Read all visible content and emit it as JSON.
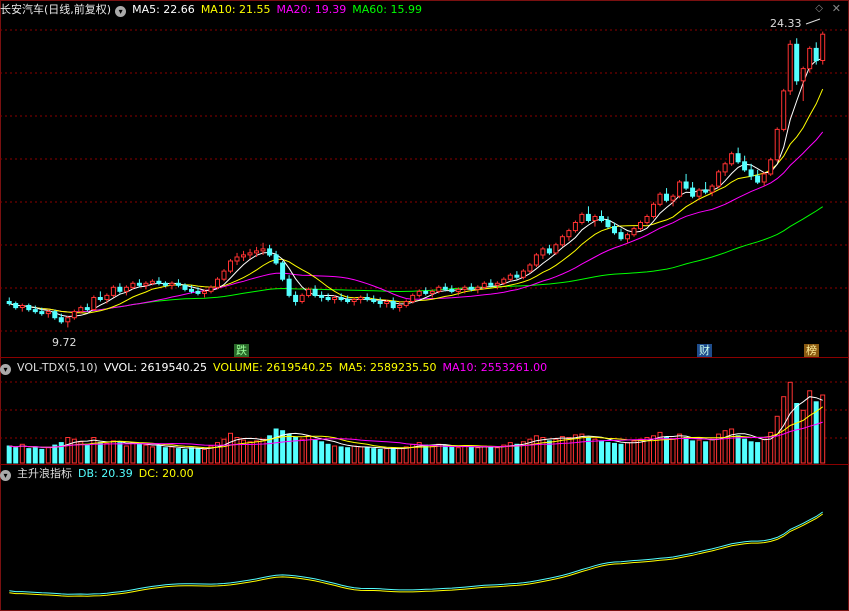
{
  "price_panel": {
    "title": "长安汽车(日线,前复权)",
    "ma5": "MA5: 22.66",
    "ma10": "MA10: 21.55",
    "ma20": "MA20: 19.39",
    "ma60": "MA60: 15.99",
    "high_label": "24.33",
    "low_label": "9.72",
    "markers": [
      "跌",
      "财",
      "榜"
    ]
  },
  "volume_panel": {
    "title": "VOL-TDX(5,10)",
    "vvol": "VVOL: 2619540.25",
    "volume": "VOLUME: 2619540.25",
    "ma5": "MA5: 2589235.50",
    "ma10": "MA10: 2553261.00"
  },
  "indicator_panel": {
    "title": "主升浪指标",
    "db": "DB: 20.39",
    "dc": "DC: 20.00"
  },
  "colors": {
    "up": "#ff3232",
    "down": "#54ffff",
    "ma5": "#ffffff",
    "ma10": "#ffff00",
    "ma20": "#ff00ff",
    "ma60": "#00ff00",
    "grid": "#8b0000"
  },
  "chart_data": [
    {
      "type": "candlestick",
      "title": "长安汽车(日线,前复权)",
      "ylim": [
        9,
        25
      ],
      "annotations": [
        {
          "label": "24.33",
          "value": 24.33
        },
        {
          "label": "9.72",
          "value": 9.72
        }
      ],
      "series": [
        {
          "name": "MA5",
          "value": 22.66
        },
        {
          "name": "MA10",
          "value": 21.55
        },
        {
          "name": "MA20",
          "value": 19.39
        },
        {
          "name": "MA60",
          "value": 15.99
        }
      ],
      "ohlc": [
        [
          11.0,
          11.2,
          10.8,
          10.9
        ],
        [
          10.9,
          11.0,
          10.6,
          10.7
        ],
        [
          10.7,
          10.9,
          10.5,
          10.8
        ],
        [
          10.8,
          10.9,
          10.5,
          10.6
        ],
        [
          10.6,
          10.8,
          10.4,
          10.5
        ],
        [
          10.5,
          10.7,
          10.3,
          10.4
        ],
        [
          10.4,
          10.6,
          10.2,
          10.5
        ],
        [
          10.5,
          10.6,
          10.1,
          10.2
        ],
        [
          10.2,
          10.4,
          9.9,
          10.0
        ],
        [
          10.0,
          10.3,
          9.72,
          10.2
        ],
        [
          10.2,
          10.6,
          10.1,
          10.5
        ],
        [
          10.5,
          10.8,
          10.4,
          10.7
        ],
        [
          10.7,
          10.9,
          10.5,
          10.6
        ],
        [
          10.6,
          11.3,
          10.6,
          11.2
        ],
        [
          11.2,
          11.5,
          11.0,
          11.1
        ],
        [
          11.1,
          11.4,
          10.9,
          11.3
        ],
        [
          11.3,
          11.8,
          11.2,
          11.7
        ],
        [
          11.7,
          11.9,
          11.4,
          11.5
        ],
        [
          11.5,
          11.8,
          11.3,
          11.7
        ],
        [
          11.7,
          12.0,
          11.6,
          11.9
        ],
        [
          11.9,
          12.1,
          11.7,
          11.8
        ],
        [
          11.8,
          12.0,
          11.6,
          11.9
        ],
        [
          11.9,
          12.1,
          11.8,
          12.0
        ],
        [
          12.0,
          12.2,
          11.8,
          11.9
        ],
        [
          11.9,
          12.0,
          11.7,
          11.8
        ],
        [
          11.8,
          12.0,
          11.6,
          11.9
        ],
        [
          11.9,
          12.1,
          11.7,
          11.8
        ],
        [
          11.8,
          11.9,
          11.5,
          11.6
        ],
        [
          11.6,
          11.8,
          11.4,
          11.5
        ],
        [
          11.5,
          11.7,
          11.3,
          11.4
        ],
        [
          11.4,
          11.6,
          11.2,
          11.5
        ],
        [
          11.5,
          11.8,
          11.4,
          11.7
        ],
        [
          11.7,
          12.2,
          11.6,
          12.1
        ],
        [
          12.1,
          12.6,
          12.0,
          12.5
        ],
        [
          12.5,
          13.1,
          12.4,
          13.0
        ],
        [
          13.0,
          13.4,
          12.8,
          13.2
        ],
        [
          13.2,
          13.5,
          13.0,
          13.3
        ],
        [
          13.3,
          13.6,
          13.1,
          13.4
        ],
        [
          13.4,
          13.7,
          13.2,
          13.5
        ],
        [
          13.5,
          13.9,
          13.3,
          13.6
        ],
        [
          13.6,
          13.8,
          13.2,
          13.3
        ],
        [
          13.3,
          13.5,
          12.8,
          12.9
        ],
        [
          12.9,
          13.0,
          12.0,
          12.1
        ],
        [
          12.1,
          12.3,
          11.2,
          11.3
        ],
        [
          11.3,
          11.5,
          10.8,
          11.0
        ],
        [
          11.0,
          11.4,
          10.9,
          11.3
        ],
        [
          11.3,
          11.7,
          11.2,
          11.6
        ],
        [
          11.6,
          11.8,
          11.2,
          11.3
        ],
        [
          11.3,
          11.5,
          11.0,
          11.2
        ],
        [
          11.2,
          11.4,
          11.0,
          11.1
        ],
        [
          11.1,
          11.3,
          10.9,
          11.2
        ],
        [
          11.2,
          11.4,
          11.0,
          11.1
        ],
        [
          11.1,
          11.3,
          10.9,
          11.0
        ],
        [
          11.0,
          11.2,
          10.8,
          11.1
        ],
        [
          11.1,
          11.3,
          10.9,
          11.2
        ],
        [
          11.2,
          11.4,
          11.0,
          11.1
        ],
        [
          11.1,
          11.3,
          10.9,
          11.0
        ],
        [
          11.0,
          11.2,
          10.7,
          10.9
        ],
        [
          10.9,
          11.1,
          10.7,
          11.0
        ],
        [
          11.0,
          11.2,
          10.6,
          10.7
        ],
        [
          10.7,
          11.0,
          10.5,
          10.8
        ],
        [
          10.8,
          11.1,
          10.7,
          11.0
        ],
        [
          11.0,
          11.4,
          10.9,
          11.3
        ],
        [
          11.3,
          11.6,
          11.2,
          11.5
        ],
        [
          11.5,
          11.7,
          11.3,
          11.4
        ],
        [
          11.4,
          11.6,
          11.2,
          11.5
        ],
        [
          11.5,
          11.8,
          11.4,
          11.7
        ],
        [
          11.7,
          11.9,
          11.5,
          11.6
        ],
        [
          11.6,
          11.8,
          11.4,
          11.5
        ],
        [
          11.5,
          11.7,
          11.3,
          11.6
        ],
        [
          11.6,
          11.8,
          11.4,
          11.7
        ],
        [
          11.7,
          11.9,
          11.5,
          11.6
        ],
        [
          11.6,
          11.8,
          11.4,
          11.7
        ],
        [
          11.7,
          12.0,
          11.6,
          11.9
        ],
        [
          11.9,
          12.1,
          11.7,
          11.8
        ],
        [
          11.8,
          12.0,
          11.6,
          11.9
        ],
        [
          11.9,
          12.2,
          11.8,
          12.1
        ],
        [
          12.1,
          12.4,
          12.0,
          12.3
        ],
        [
          12.3,
          12.5,
          12.1,
          12.2
        ],
        [
          12.2,
          12.6,
          12.1,
          12.5
        ],
        [
          12.5,
          12.9,
          12.4,
          12.8
        ],
        [
          12.8,
          13.4,
          12.7,
          13.3
        ],
        [
          13.3,
          13.7,
          13.1,
          13.6
        ],
        [
          13.6,
          13.8,
          13.3,
          13.4
        ],
        [
          13.4,
          13.9,
          13.3,
          13.8
        ],
        [
          13.8,
          14.3,
          13.7,
          14.2
        ],
        [
          14.2,
          14.6,
          14.0,
          14.5
        ],
        [
          14.5,
          15.0,
          14.4,
          14.9
        ],
        [
          14.9,
          15.4,
          14.8,
          15.3
        ],
        [
          15.3,
          15.7,
          14.9,
          15.0
        ],
        [
          15.0,
          15.3,
          14.7,
          15.2
        ],
        [
          15.2,
          15.5,
          14.9,
          15.0
        ],
        [
          15.0,
          15.2,
          14.6,
          14.7
        ],
        [
          14.7,
          14.9,
          14.3,
          14.4
        ],
        [
          14.4,
          14.6,
          14.0,
          14.1
        ],
        [
          14.1,
          14.4,
          13.9,
          14.3
        ],
        [
          14.3,
          14.7,
          14.2,
          14.6
        ],
        [
          14.6,
          15.0,
          14.5,
          14.9
        ],
        [
          14.9,
          15.3,
          14.8,
          15.2
        ],
        [
          15.2,
          15.9,
          15.1,
          15.8
        ],
        [
          15.8,
          16.4,
          15.7,
          16.3
        ],
        [
          16.3,
          16.6,
          15.9,
          16.0
        ],
        [
          16.0,
          16.3,
          15.7,
          16.2
        ],
        [
          16.2,
          17.0,
          16.1,
          16.9
        ],
        [
          16.9,
          17.3,
          16.5,
          16.6
        ],
        [
          16.6,
          16.9,
          16.1,
          16.2
        ],
        [
          16.2,
          16.6,
          16.0,
          16.5
        ],
        [
          16.5,
          16.9,
          16.3,
          16.4
        ],
        [
          16.4,
          16.8,
          16.2,
          16.7
        ],
        [
          16.7,
          17.5,
          16.6,
          17.4
        ],
        [
          17.4,
          17.9,
          17.2,
          17.8
        ],
        [
          17.8,
          18.4,
          17.7,
          18.3
        ],
        [
          18.3,
          18.6,
          17.8,
          17.9
        ],
        [
          17.9,
          18.2,
          17.4,
          17.5
        ],
        [
          17.5,
          17.8,
          17.0,
          17.2
        ],
        [
          17.2,
          17.5,
          16.8,
          16.9
        ],
        [
          16.9,
          17.4,
          16.7,
          17.3
        ],
        [
          17.3,
          18.1,
          17.2,
          18.0
        ],
        [
          18.0,
          19.6,
          17.9,
          19.5
        ],
        [
          19.5,
          21.5,
          19.4,
          21.4
        ],
        [
          21.4,
          23.9,
          21.2,
          23.7
        ],
        [
          23.7,
          24.0,
          21.7,
          21.9
        ],
        [
          21.9,
          22.6,
          20.9,
          22.5
        ],
        [
          22.5,
          23.6,
          22.3,
          23.5
        ],
        [
          23.5,
          23.8,
          22.7,
          22.9
        ],
        [
          22.9,
          24.33,
          22.7,
          24.2
        ]
      ]
    },
    {
      "type": "bar",
      "title": "VOL-TDX(5,10)",
      "series": [
        {
          "name": "VVOL",
          "value": 2619540.25
        },
        {
          "name": "VOLUME",
          "value": 2619540.25
        },
        {
          "name": "MA5",
          "value": 2589235.5
        },
        {
          "name": "MA10",
          "value": 2553261.0
        }
      ],
      "values": [
        0.2,
        0.18,
        0.22,
        0.17,
        0.19,
        0.16,
        0.18,
        0.21,
        0.24,
        0.3,
        0.28,
        0.25,
        0.22,
        0.3,
        0.24,
        0.23,
        0.26,
        0.24,
        0.2,
        0.24,
        0.22,
        0.21,
        0.19,
        0.2,
        0.18,
        0.19,
        0.17,
        0.16,
        0.18,
        0.17,
        0.16,
        0.2,
        0.24,
        0.28,
        0.35,
        0.3,
        0.27,
        0.25,
        0.26,
        0.28,
        0.32,
        0.4,
        0.38,
        0.34,
        0.3,
        0.28,
        0.32,
        0.27,
        0.25,
        0.22,
        0.2,
        0.19,
        0.18,
        0.2,
        0.19,
        0.18,
        0.17,
        0.16,
        0.17,
        0.18,
        0.17,
        0.19,
        0.22,
        0.24,
        0.21,
        0.2,
        0.22,
        0.21,
        0.19,
        0.18,
        0.2,
        0.19,
        0.18,
        0.2,
        0.19,
        0.18,
        0.21,
        0.24,
        0.22,
        0.25,
        0.28,
        0.32,
        0.3,
        0.26,
        0.28,
        0.31,
        0.3,
        0.33,
        0.34,
        0.3,
        0.28,
        0.26,
        0.24,
        0.23,
        0.22,
        0.24,
        0.26,
        0.28,
        0.3,
        0.32,
        0.36,
        0.3,
        0.28,
        0.34,
        0.3,
        0.26,
        0.27,
        0.25,
        0.28,
        0.34,
        0.38,
        0.4,
        0.32,
        0.28,
        0.25,
        0.24,
        0.28,
        0.36,
        0.55,
        0.78,
        0.95,
        0.7,
        0.62,
        0.85,
        0.72,
        0.8
      ]
    },
    {
      "type": "line",
      "title": "主升浪指标",
      "series": [
        {
          "name": "DB",
          "value": 20.39
        },
        {
          "name": "DC",
          "value": 20.0
        }
      ]
    }
  ]
}
